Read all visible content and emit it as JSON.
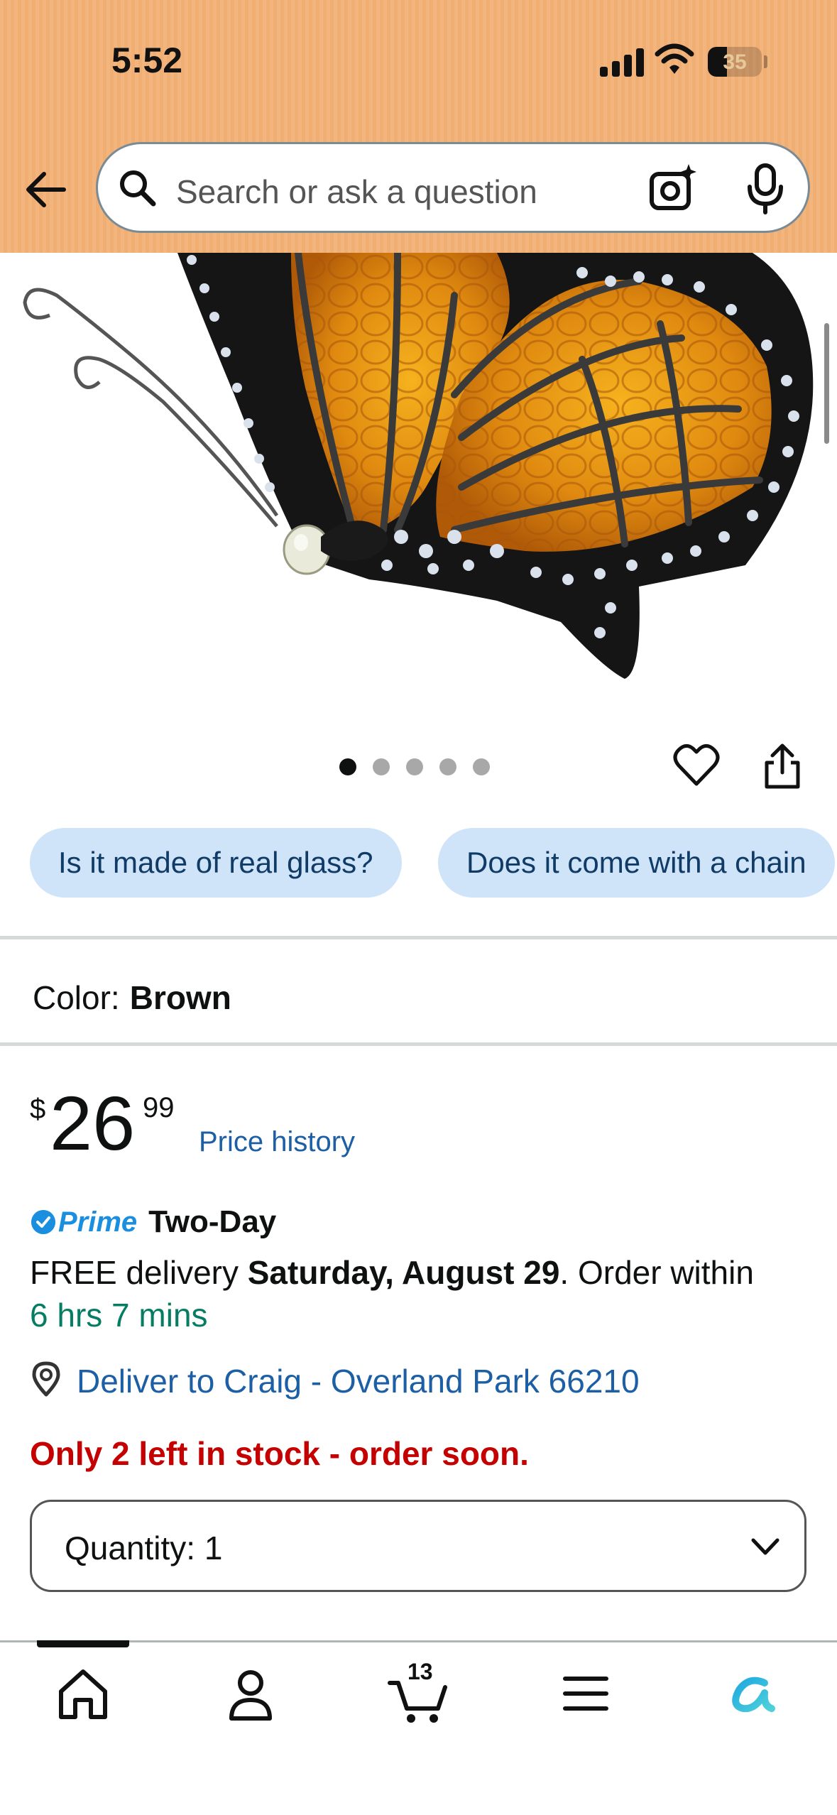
{
  "status_bar": {
    "time": "5:52",
    "battery": "35",
    "battery_level": 0.35
  },
  "search": {
    "placeholder": "Search or ask a question"
  },
  "product": {
    "image_count": 5,
    "active_image": 0,
    "color_label": "Color:",
    "color_value": "Brown",
    "price": {
      "symbol": "$",
      "whole": "26",
      "fraction": "99"
    },
    "price_history_label": "Price history"
  },
  "questions": [
    "Is it made of real glass?",
    "Does it come with a chain"
  ],
  "delivery": {
    "prime_label": "Prime",
    "prime_speed": "Two-Day",
    "free_delivery_prefix": "FREE delivery ",
    "date": "Saturday, August 29",
    "order_within_text": ". Order within",
    "countdown": "6 hrs 7 mins",
    "deliver_to": "Deliver to Craig - Overland Park 66210"
  },
  "stock_message": "Only 2 left in stock - order soon.",
  "quantity": {
    "label": "Quantity:",
    "value": "1"
  },
  "tabbar": {
    "items": [
      "home-icon",
      "account-icon",
      "cart-icon",
      "menu-icon",
      "rufus-icon"
    ],
    "cart_count": "13",
    "active_index": 0
  },
  "colors": {
    "header_bg": "#f3b57e",
    "link": "#1c5fa5",
    "prime_blue": "#1a8fe0",
    "in_stock_red": "#c40000",
    "countdown_green": "#067d62",
    "chip_bg": "#cfe3f9"
  }
}
